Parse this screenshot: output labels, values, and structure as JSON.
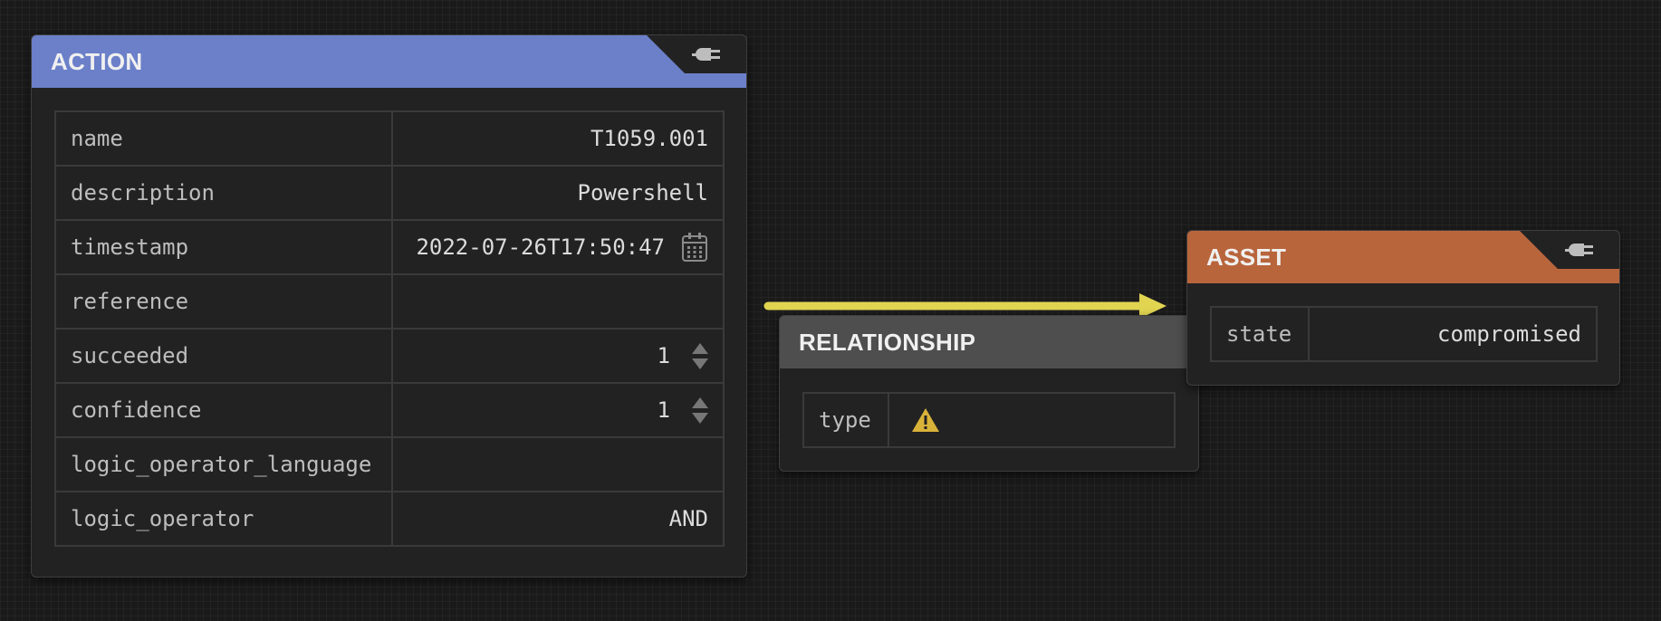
{
  "colors": {
    "action_header": "#6b80c9",
    "relationship_header": "#4e4e4e",
    "asset_header": "#b8653c",
    "edge": "#e1d451",
    "warning": "#d9b23a"
  },
  "action": {
    "title": "ACTION",
    "header_icon": "plug-icon",
    "rows": [
      {
        "key": "name",
        "value": "T1059.001",
        "widget": "text"
      },
      {
        "key": "description",
        "value": "Powershell",
        "widget": "text"
      },
      {
        "key": "timestamp",
        "value": "2022-07-26T17:50:47",
        "widget": "calendar"
      },
      {
        "key": "reference",
        "value": "",
        "widget": "text"
      },
      {
        "key": "succeeded",
        "value": "1",
        "widget": "stepper"
      },
      {
        "key": "confidence",
        "value": "1",
        "widget": "stepper"
      },
      {
        "key": "logic_operator_language",
        "value": "",
        "widget": "text"
      },
      {
        "key": "logic_operator",
        "value": "AND",
        "widget": "text"
      }
    ]
  },
  "relationship": {
    "title": "RELATIONSHIP",
    "rows": [
      {
        "key": "type",
        "value": "",
        "widget": "warning",
        "icon": "warning-icon"
      }
    ]
  },
  "asset": {
    "title": "ASSET",
    "header_icon": "plug-icon",
    "rows": [
      {
        "key": "state",
        "value": "compromised",
        "widget": "text"
      }
    ]
  }
}
